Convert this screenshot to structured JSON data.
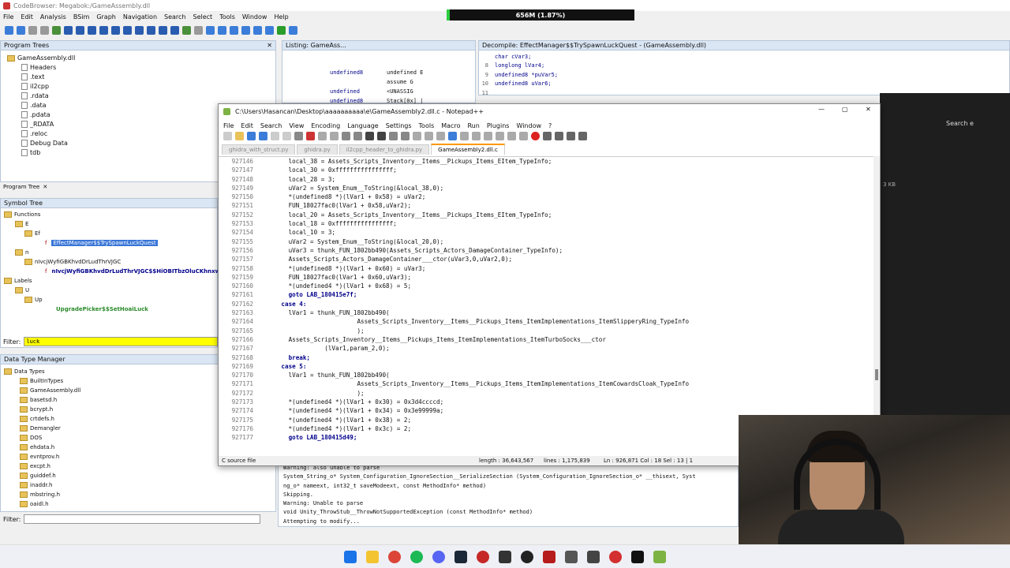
{
  "ghidra": {
    "title": "CodeBrowser: Megabok:/GameAssembly.dll",
    "menu": [
      "File",
      "Edit",
      "Analysis",
      "BSim",
      "Graph",
      "Navigation",
      "Search",
      "Select",
      "Tools",
      "Window",
      "Help"
    ],
    "memory": "656M (1.87%)",
    "program_trees": {
      "title": "Program Trees",
      "root": "GameAssembly.dll",
      "items": [
        "Headers",
        ".text",
        "il2cpp",
        ".rdata",
        ".data",
        ".pdata",
        "_RDATA",
        ".reloc",
        "Debug Data",
        "tdb"
      ],
      "footer_tab": "Program Tree"
    },
    "symbol_tree": {
      "title": "Symbol Tree",
      "functions": "Functions",
      "e": "E",
      "ef": "Ef",
      "selected": "EffectManager$$TrySpawnLuckQuest",
      "n": "n",
      "n1": "nIvcjWyfiGBKhvdDrLudThrVJGC",
      "n2": "nIvcjWyfiGBKhvdDrLudThrVJGC$$HiOBITbzOluCKhnxwXKuyuWI",
      "labels": "Labels",
      "u": "U",
      "up": "Up",
      "upgrade": "UpgradePicker$$SetHoaiLuck",
      "filter_label": "Filter:",
      "filter_value": "luck"
    },
    "data_type_manager": {
      "title": "Data Type Manager",
      "root": "Data Types",
      "items": [
        "BuiltInTypes",
        "GameAssembly.dll",
        "basetsd.h",
        "bcrypt.h",
        "crtdefs.h",
        "Demangler",
        "DOS",
        "ehdata.h",
        "evntprov.h",
        "excpt.h",
        "guiddef.h",
        "inaddr.h",
        "mbstring.h",
        "oaidl.h"
      ],
      "filter_label": "Filter:"
    },
    "listing": {
      "title": "Listing:  GameAss...",
      "lines": [
        {
          "t": "undefined8",
          "v": "undefined E"
        },
        {
          "t": "",
          "v": "assume G"
        },
        {
          "t": "undefined",
          "v": "<UNASSIG"
        },
        {
          "t": "undefined8",
          "v": "Stack[0x] |"
        }
      ]
    },
    "decompile": {
      "title": "Decompile: EffectManager$$TrySpawnLuckQuest - (GameAssembly.dll)",
      "lines": [
        {
          "n": "",
          "c": "char cVar3;"
        },
        {
          "n": "8",
          "c": "longlong lVar4;"
        },
        {
          "n": "9",
          "c": "undefined8 *puVar5;"
        },
        {
          "n": "10",
          "c": "undefined8 uVar6;"
        },
        {
          "n": "11",
          "c": ""
        }
      ]
    },
    "console": [
      "Warning: also unable to parse",
      "System_String_o* System_Configuration_IgnoreSection__SerializeSection (System_Configuration_IgnoreSection_o* __thisext, Syst",
      "ng_o* nameext, int32_t saveModeext, const MethodInfo* method)",
      "Skipping.",
      "Warning: Unable to parse",
      "void Unity_ThrowStub__ThrowNotSupportedException (const MethodInfo* method)",
      "Attempting to modify..."
    ],
    "search_hint": "Search e",
    "size_hint": "3 KB"
  },
  "notepad": {
    "title": "C:\\Users\\Hasancan\\Desktop\\aaaaaaaaaa\\e\\GameAssembly2.dll.c - Notepad++",
    "menu": [
      "File",
      "Edit",
      "Search",
      "View",
      "Encoding",
      "Language",
      "Settings",
      "Tools",
      "Macro",
      "Run",
      "Plugins",
      "Window",
      "?"
    ],
    "tabs": [
      "ghidra_with_struct.py",
      "ghidra.py",
      "il2cpp_header_to_ghidra.py",
      "GameAssembly2.dll.c"
    ],
    "code": [
      {
        "n": "927146",
        "c": "        local_38 = Assets_Scripts_Inventory__Items__Pickups_Items_EItem_TypeInfo;"
      },
      {
        "n": "927147",
        "c": "        local_30 = 0xffffffffffffffff;"
      },
      {
        "n": "927148",
        "c": "        local_28 = 3;"
      },
      {
        "n": "927149",
        "c": "        uVar2 = System_Enum__ToString(&local_38,0);"
      },
      {
        "n": "927150",
        "c": "        *(undefined8 *)(lVar1 + 0x58) = uVar2;"
      },
      {
        "n": "927151",
        "c": "        FUN_18027fac0(lVar1 + 0x58,uVar2);"
      },
      {
        "n": "927152",
        "c": "        local_20 = Assets_Scripts_Inventory__Items__Pickups_Items_EItem_TypeInfo;"
      },
      {
        "n": "927153",
        "c": "        local_18 = 0xffffffffffffffff;"
      },
      {
        "n": "927154",
        "c": "        local_10 = 3;"
      },
      {
        "n": "927155",
        "c": "        uVar2 = System_Enum__ToString(&local_20,0);"
      },
      {
        "n": "927156",
        "c": "        uVar3 = thunk_FUN_1802bb490(Assets_Scripts_Actors_DamageContainer_TypeInfo);"
      },
      {
        "n": "927157",
        "c": "        Assets_Scripts_Actors_DamageContainer___ctor(uVar3,0,uVar2,0);"
      },
      {
        "n": "927158",
        "c": "        *(undefined8 *)(lVar1 + 0x60) = uVar3;"
      },
      {
        "n": "927159",
        "c": "        FUN_18027fac0(lVar1 + 0x60,uVar3);"
      },
      {
        "n": "927160",
        "c": "        *(undefined4 *)(lVar1 + 0x68) = 5;"
      },
      {
        "n": "927161",
        "c": "        goto LAB_180415e7f;"
      },
      {
        "n": "927162",
        "c": "      case 4:"
      },
      {
        "n": "927163",
        "c": "        lVar1 = thunk_FUN_1802bb490("
      },
      {
        "n": "927164",
        "c": "                           Assets_Scripts_Inventory__Items__Pickups_Items_ItemImplementations_ItemSlipperyRing_TypeInfo"
      },
      {
        "n": "927165",
        "c": "                           );"
      },
      {
        "n": "927166",
        "c": "        Assets_Scripts_Inventory__Items__Pickups_Items_ItemImplementations_ItemTurboSocks___ctor"
      },
      {
        "n": "927167",
        "c": "                  (lVar1,param_2,0);"
      },
      {
        "n": "927168",
        "c": "        break;"
      },
      {
        "n": "927169",
        "c": "      case 5:"
      },
      {
        "n": "927170",
        "c": "        lVar1 = thunk_FUN_1802bb490("
      },
      {
        "n": "927171",
        "c": "                           Assets_Scripts_Inventory__Items__Pickups_Items_ItemImplementations_ItemCowardsCloak_TypeInfo"
      },
      {
        "n": "927172",
        "c": "                           );"
      },
      {
        "n": "927173",
        "c": "        *(undefined4 *)(lVar1 + 0x30) = 0x3d4ccccd;"
      },
      {
        "n": "927174",
        "c": "        *(undefined4 *)(lVar1 + 0x34) = 0x3e99999a;"
      },
      {
        "n": "927175",
        "c": "        *(undefined4 *)(lVar1 + 0x38) = 2;"
      },
      {
        "n": "927176",
        "c": "        *(undefined4 *)(lVar1 + 0x3c) = 2;"
      },
      {
        "n": "927177",
        "c": "        goto LAB_180415d49;"
      }
    ],
    "status": {
      "type": "C source file",
      "length": "length : 36,643,567",
      "lines": "lines : 1,175,839",
      "pos": "Ln : 926,871    Col : 18    Sel : 13 | 1"
    }
  }
}
